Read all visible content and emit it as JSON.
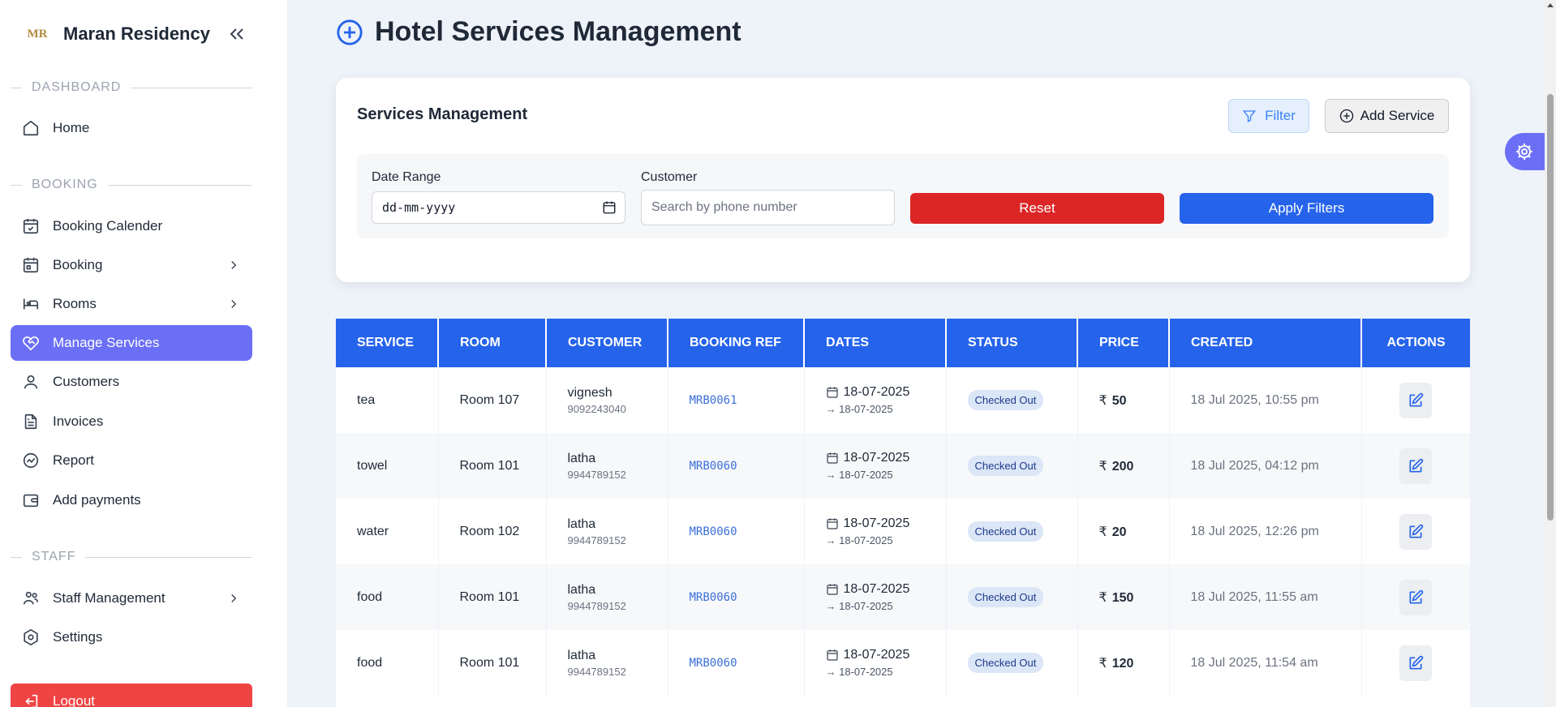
{
  "brand": {
    "name": "Maran Residency",
    "logo_text": "MR"
  },
  "sidebar": {
    "sections": [
      {
        "title": "DASHBOARD"
      },
      {
        "title": "BOOKING"
      },
      {
        "title": "STAFF"
      }
    ],
    "items": [
      {
        "label": "Home"
      },
      {
        "label": "Booking Calender"
      },
      {
        "label": "Booking"
      },
      {
        "label": "Rooms"
      },
      {
        "label": "Manage Services"
      },
      {
        "label": "Customers"
      },
      {
        "label": "Invoices"
      },
      {
        "label": "Report"
      },
      {
        "label": "Add payments"
      },
      {
        "label": "Staff Management"
      },
      {
        "label": "Settings"
      }
    ],
    "logout_label": "Logout"
  },
  "header": {
    "title": "Hotel Services Management"
  },
  "card": {
    "title": "Services Management",
    "filter_label": "Filter",
    "add_label": "Add Service",
    "date_label": "Date Range",
    "date_value": "dd-mm-yyyy",
    "customer_label": "Customer",
    "customer_placeholder": "Search by phone number",
    "reset_label": "Reset",
    "apply_label": "Apply Filters"
  },
  "table": {
    "columns": [
      "SERVICE",
      "ROOM",
      "CUSTOMER",
      "BOOKING REF",
      "DATES",
      "STATUS",
      "PRICE",
      "CREATED",
      "ACTIONS"
    ],
    "rows": [
      {
        "service": "tea",
        "room": "Room 107",
        "customer": "vignesh",
        "phone": "9092243040",
        "ref": "MRB0061",
        "date_from": "18-07-2025",
        "date_to": "18-07-2025",
        "status": "Checked Out",
        "price": "50",
        "created": "18 Jul 2025, 10:55 pm"
      },
      {
        "service": "towel",
        "room": "Room 101",
        "customer": "latha",
        "phone": "9944789152",
        "ref": "MRB0060",
        "date_from": "18-07-2025",
        "date_to": "18-07-2025",
        "status": "Checked Out",
        "price": "200",
        "created": "18 Jul 2025, 04:12 pm"
      },
      {
        "service": "water",
        "room": "Room 102",
        "customer": "latha",
        "phone": "9944789152",
        "ref": "MRB0060",
        "date_from": "18-07-2025",
        "date_to": "18-07-2025",
        "status": "Checked Out",
        "price": "20",
        "created": "18 Jul 2025, 12:26 pm"
      },
      {
        "service": "food",
        "room": "Room 101",
        "customer": "latha",
        "phone": "9944789152",
        "ref": "MRB0060",
        "date_from": "18-07-2025",
        "date_to": "18-07-2025",
        "status": "Checked Out",
        "price": "150",
        "created": "18 Jul 2025, 11:55 am"
      },
      {
        "service": "food",
        "room": "Room 101",
        "customer": "latha",
        "phone": "9944789152",
        "ref": "MRB0060",
        "date_from": "18-07-2025",
        "date_to": "18-07-2025",
        "status": "Checked Out",
        "price": "120",
        "created": "18 Jul 2025, 11:54 am"
      }
    ],
    "currency_symbol": "₹"
  },
  "colors": {
    "accent": "#2563eb",
    "active_nav": "#6b6ff6",
    "danger": "#dc2626",
    "logout": "#ef4444"
  },
  "icons": {
    "settings_fab": "gear-icon",
    "edit": "edit-icon"
  }
}
